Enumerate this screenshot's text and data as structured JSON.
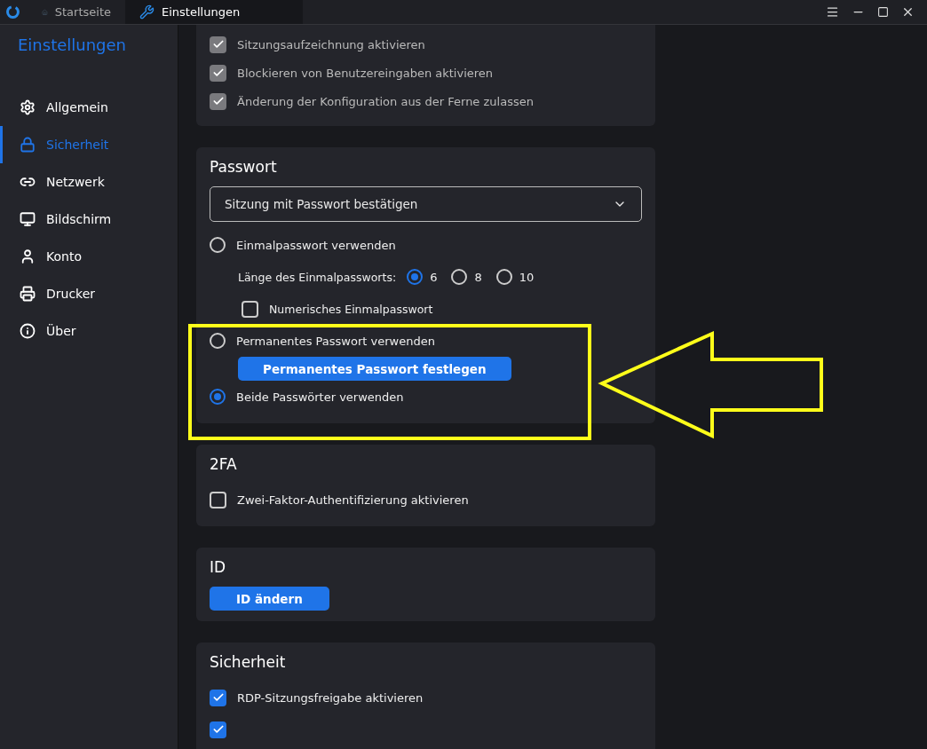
{
  "tabs": [
    {
      "label": "Startseite",
      "selected": false
    },
    {
      "label": "Einstellungen",
      "selected": true
    }
  ],
  "sidebar": {
    "title": "Einstellungen",
    "items": [
      {
        "label": "Allgemein",
        "selected": false
      },
      {
        "label": "Sicherheit",
        "selected": true
      },
      {
        "label": "Netzwerk",
        "selected": false
      },
      {
        "label": "Bildschirm",
        "selected": false
      },
      {
        "label": "Konto",
        "selected": false
      },
      {
        "label": "Drucker",
        "selected": false
      },
      {
        "label": "Über",
        "selected": false
      }
    ]
  },
  "permissions": {
    "options": [
      {
        "label": "Sitzungsaufzeichnung aktivieren",
        "checked": true,
        "disabled": true
      },
      {
        "label": "Blockieren von Benutzereingaben aktivieren",
        "checked": true,
        "disabled": true
      },
      {
        "label": "Änderung der Konfiguration aus der Ferne zulassen",
        "checked": true,
        "disabled": true
      }
    ]
  },
  "password": {
    "title": "Passwort",
    "dropdown": {
      "value": "Sitzung mit Passwort bestätigen"
    },
    "one_time": {
      "label": "Einmalpasswort verwenden",
      "selected": false
    },
    "length": {
      "label": "Länge des Einmalpassworts:",
      "options": [
        {
          "label": "6",
          "selected": true
        },
        {
          "label": "8",
          "selected": false
        },
        {
          "label": "10",
          "selected": false
        }
      ]
    },
    "numeric": {
      "label": "Numerisches Einmalpasswort",
      "checked": false
    },
    "permanent": {
      "label": "Permanentes Passwort verwenden",
      "selected": false
    },
    "set_button": "Permanentes Passwort festlegen",
    "both": {
      "label": "Beide Passwörter verwenden",
      "selected": true
    }
  },
  "twofa": {
    "title": "2FA",
    "option": {
      "label": "Zwei-Faktor-Authentifizierung aktivieren",
      "checked": false
    }
  },
  "id": {
    "title": "ID",
    "button": "ID ändern"
  },
  "security": {
    "title": "Sicherheit",
    "options": [
      {
        "label": "RDP-Sitzungsfreigabe aktivieren",
        "checked": true
      },
      {
        "checked": true
      }
    ]
  }
}
